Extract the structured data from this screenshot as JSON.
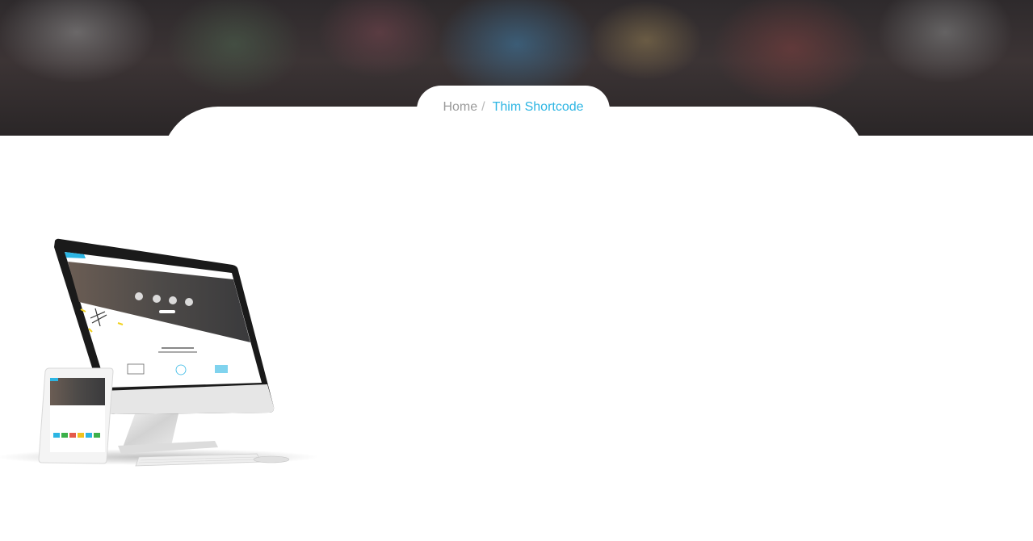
{
  "breadcrumb": {
    "home": "Home",
    "separator": "/",
    "current": "Thim Shortcode"
  },
  "colors": {
    "accent": "#2cb5e3",
    "muted": "#9a9a9a"
  },
  "image": {
    "alt": "Responsive devices mockup"
  }
}
